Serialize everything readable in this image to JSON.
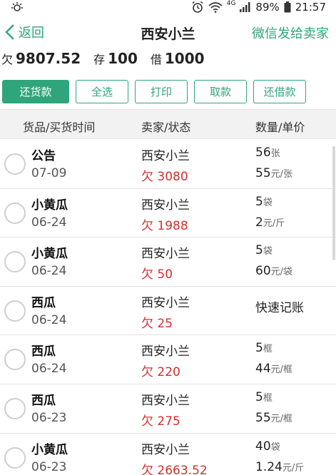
{
  "status": {
    "network": "4G",
    "battery": "89%",
    "time": "21:57"
  },
  "header": {
    "back_label": "返回",
    "title": "西安小兰",
    "wechat_label": "微信发给卖家"
  },
  "summary": {
    "debt_label": "欠",
    "debt_value": "9807.52",
    "stock_label": "存",
    "stock_value": "100",
    "borrow_label": "借",
    "borrow_value": "1000"
  },
  "actions": [
    "还货款",
    "全选",
    "打印",
    "取款",
    "还借款"
  ],
  "table": {
    "headers": [
      "货品/买货时间",
      "卖家/状态",
      "数量/单价"
    ],
    "rows": [
      {
        "name": "公告",
        "date": "07-09",
        "seller": "西安小兰",
        "debt": "欠 3080",
        "qty": "56",
        "qty_unit": "张",
        "price": "55",
        "price_unit": "元/张"
      },
      {
        "name": "小黄瓜",
        "date": "06-24",
        "seller": "西安小兰",
        "debt": "欠 1988",
        "qty": "5",
        "qty_unit": "袋",
        "price": "2",
        "price_unit": "元/斤"
      },
      {
        "name": "小黄瓜",
        "date": "06-24",
        "seller": "西安小兰",
        "debt": "欠 50",
        "qty": "5",
        "qty_unit": "袋",
        "price": "60",
        "price_unit": "元/袋"
      },
      {
        "name": "西瓜",
        "date": "06-24",
        "seller": "西安小兰",
        "debt": "欠 25",
        "quick": "快速记账"
      },
      {
        "name": "西瓜",
        "date": "06-24",
        "seller": "西安小兰",
        "debt": "欠 220",
        "qty": "5",
        "qty_unit": "框",
        "price": "44",
        "price_unit": "元/框"
      },
      {
        "name": "西瓜",
        "date": "06-23",
        "seller": "西安小兰",
        "debt": "欠 275",
        "qty": "5",
        "qty_unit": "框",
        "price": "55",
        "price_unit": "元/框"
      },
      {
        "name": "小黄瓜",
        "date": "06-23",
        "seller": "西安小兰",
        "debt": "欠 2663.52",
        "qty": "40",
        "qty_unit": "袋",
        "price": "1.24",
        "price_unit": "元/斤"
      }
    ]
  },
  "colors": {
    "accent": "#2fa57c",
    "debt": "#d32f2f"
  },
  "icons": [
    "sync-icon",
    "alarm-icon",
    "wifi-icon",
    "signal-icon",
    "battery-icon",
    "back-chevron-icon"
  ]
}
